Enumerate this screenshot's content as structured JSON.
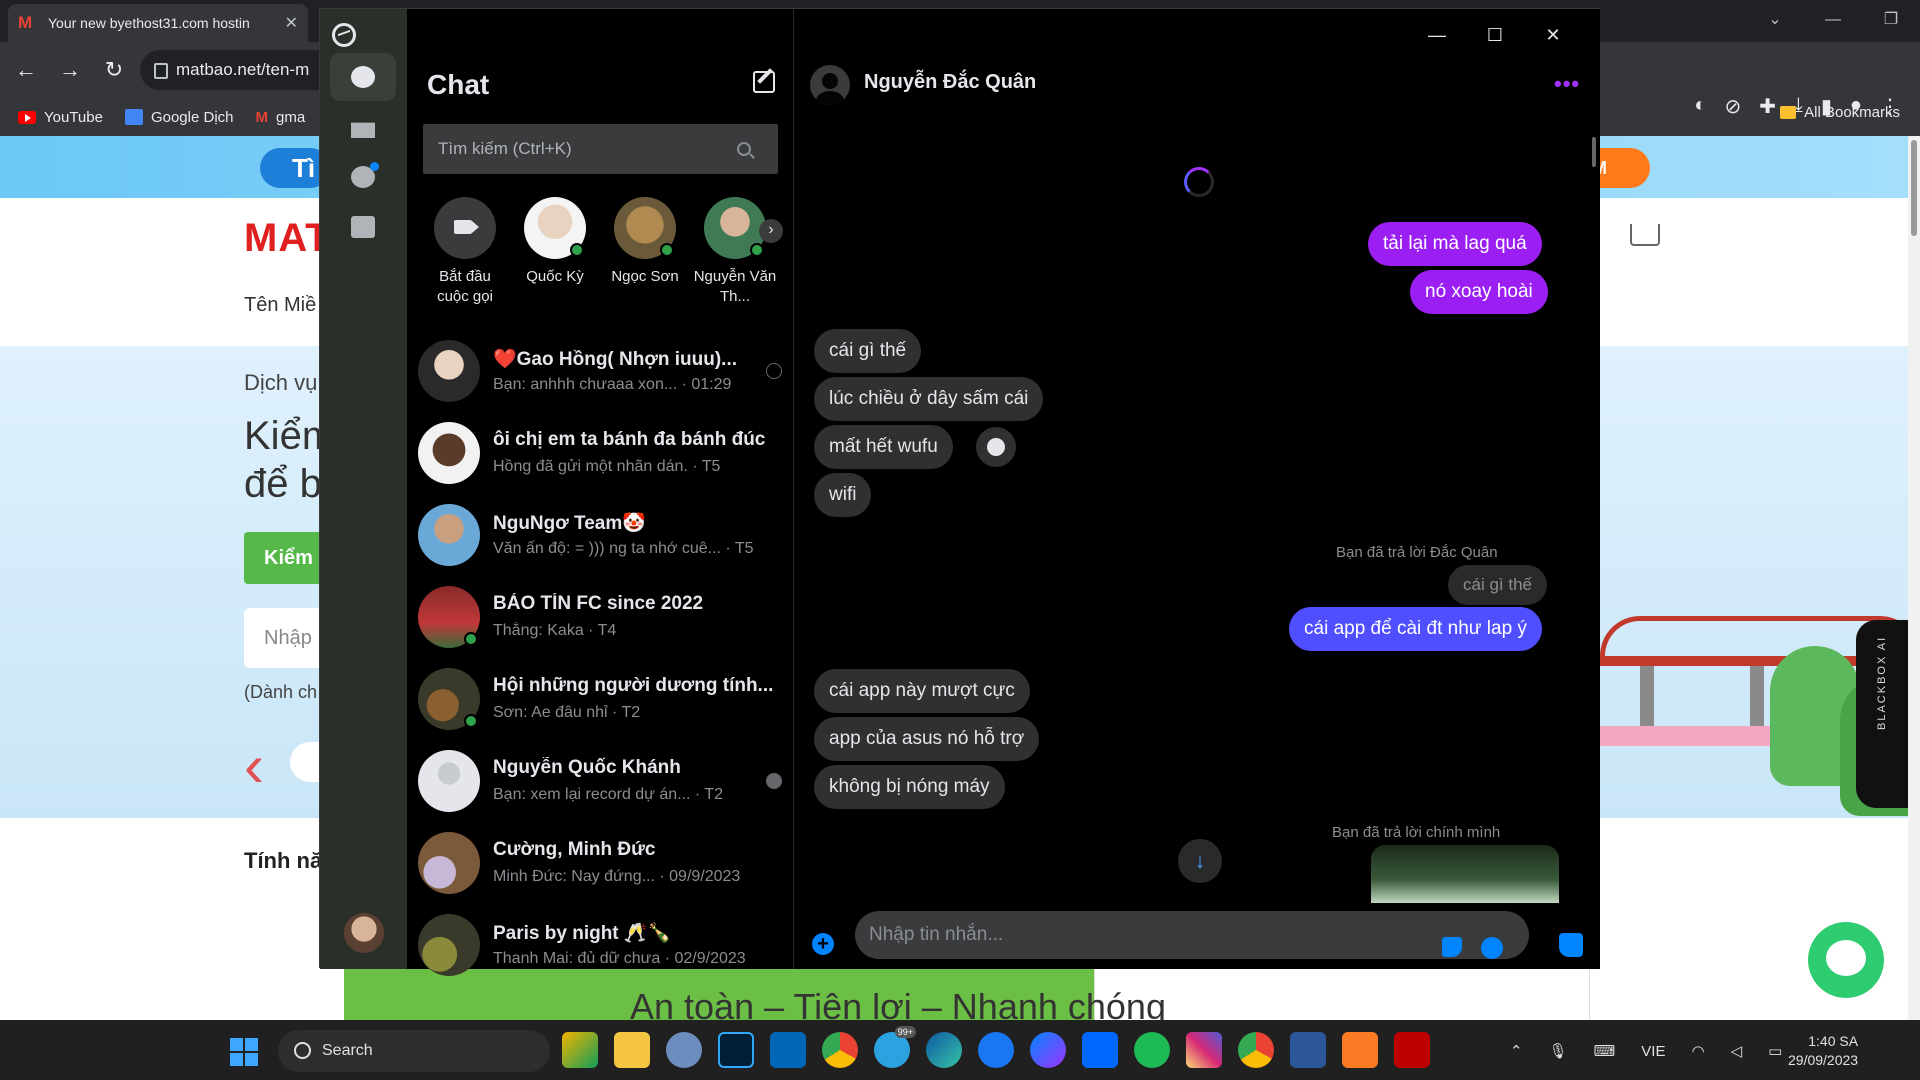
{
  "browser": {
    "tab_title": "Your new byethost31.com hostin",
    "url": "matbao.net/ten-m",
    "bookmarks": [
      "YouTube",
      "Google Dịch",
      "gma"
    ],
    "all_bookmarks": "All Bookmarks"
  },
  "webpage": {
    "pill_left": "Tì",
    "pill_right": "M",
    "logo": "MAT",
    "nav": "Tên Miề",
    "hero_sub": "Dịch vụ",
    "hero_title_1": "Kiểm",
    "hero_title_2": "để b",
    "hero_button": "Kiểm",
    "hero_input": "Nhập",
    "hero_note": "(Dành ch",
    "features": "Tính nă",
    "bottom_text": "An toàn – Tiện lợi – Nhanh chóng",
    "blackbox": "BLACKBOX AI"
  },
  "messenger": {
    "sidebar_title": "Chat",
    "search_placeholder": "Tìm kiếm (Ctrl+K)",
    "stories": [
      {
        "label": "Bắt đầu cuộc gọi"
      },
      {
        "label": "Quốc Kỳ"
      },
      {
        "label": "Ngọc Sơn"
      },
      {
        "label": "Nguyễn Văn Th..."
      }
    ],
    "conversations": [
      {
        "name": "❤️Gao Hồng( Nhợn iuuu)...",
        "preview": "Bạn: anhhh chưaaa xon... · 01:29"
      },
      {
        "name": "ôi chị em ta bánh đa bánh đúc",
        "preview": "Hồng đã gửi một nhãn dán. · T5"
      },
      {
        "name": "NguNgơ Team🤡",
        "preview": "Văn ấn độ: = ))) ng ta nhớ cuê... · T5"
      },
      {
        "name": "BẢO TÍN FC since 2022",
        "preview": "Thắng: Kaka · T4"
      },
      {
        "name": "Hội những người dương tính...",
        "preview": "Sơn: Ae đâu nhỉ · T2"
      },
      {
        "name": "Nguyễn Quốc Khánh",
        "preview": "Bạn: xem lại record dự án... · T2"
      },
      {
        "name": "Cường, Minh Đức",
        "preview": "Minh Đức: Nay đứng... · 09/9/2023"
      },
      {
        "name": "Paris by night 🥂🍾",
        "preview": "Thanh Mai: đủ dữ chưa · 02/9/2023"
      }
    ],
    "chat": {
      "contact_name": "Nguyễn Đắc Quân",
      "more": "•••",
      "messages": {
        "out1": "tải lại mà lag quá",
        "out2": "nó xoay hoài",
        "in1": "cái gì thế",
        "in2": "lúc chiều ở dây sấm cái",
        "in3": "mất hết wufu",
        "in4": "wifi",
        "reply_note1": "Bạn đã trả lời Đắc Quân",
        "quote1": "cái gì thế",
        "out3": "cái app để cài đt như lap ý",
        "in5": "cái app này mượt cực",
        "in6": "app của asus nó hỗ trợ",
        "in7": "không bị nóng máy",
        "reply_note2": "Bạn đã trả lời chính mình"
      },
      "composer_placeholder": "Nhập tin nhắn..."
    }
  },
  "taskbar": {
    "search": "Search",
    "badge": "99+",
    "lang": "VIE",
    "time": "1:40 SA",
    "date": "29/09/2023"
  },
  "colors": {
    "outgoing_purple": "#9b1ff2",
    "outgoing_blue": "#4f4fff",
    "incoming": "#303030",
    "accent": "#0084ff"
  }
}
